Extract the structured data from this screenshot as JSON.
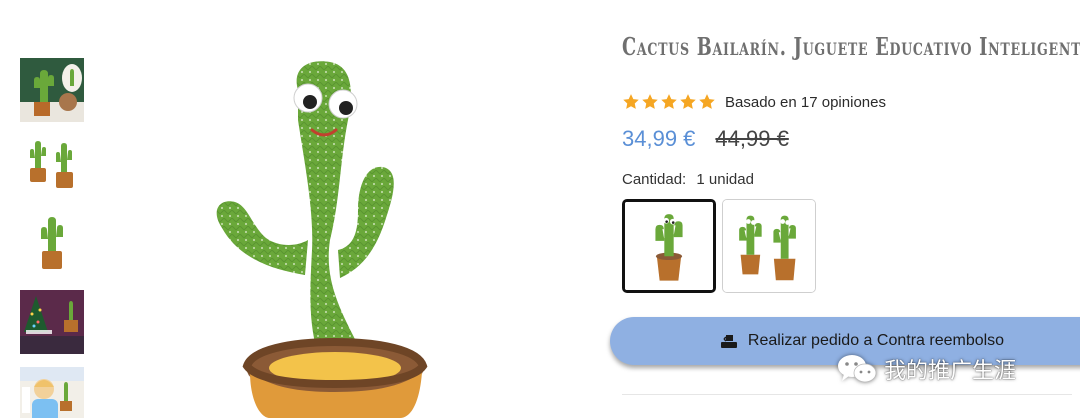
{
  "product": {
    "title": "Cactus Bailarín. Juguete Educativo Inteligente",
    "rating": {
      "stars": 5,
      "max": 5,
      "text": "Basado en 17 opiniones"
    },
    "price": {
      "sale": "34,99 €",
      "original": "44,99 €"
    },
    "quantity": {
      "label": "Cantidad:",
      "value": "1 unidad"
    },
    "variants": [
      {
        "name": "1 cactus",
        "selected": true
      },
      {
        "name": "2 cactus",
        "selected": false
      }
    ]
  },
  "thumbnails": [
    {
      "name": "thumb-cactus-lifestyle"
    },
    {
      "name": "thumb-two-cacti"
    },
    {
      "name": "thumb-single-cactus"
    },
    {
      "name": "thumb-christmas-tree"
    },
    {
      "name": "thumb-kids-playing"
    }
  ],
  "order_button": {
    "label": "Realizar pedido a Contra reembolso",
    "icon": "cash-on-delivery-icon"
  },
  "watermark": {
    "text": "我的推广生涯",
    "icon": "wechat-icon"
  },
  "colors": {
    "accent": "#5a8fd6",
    "button": "#8fb0e2",
    "star": "#f5a623",
    "cactus": "#6aa83a",
    "pot": "#c8782f"
  }
}
